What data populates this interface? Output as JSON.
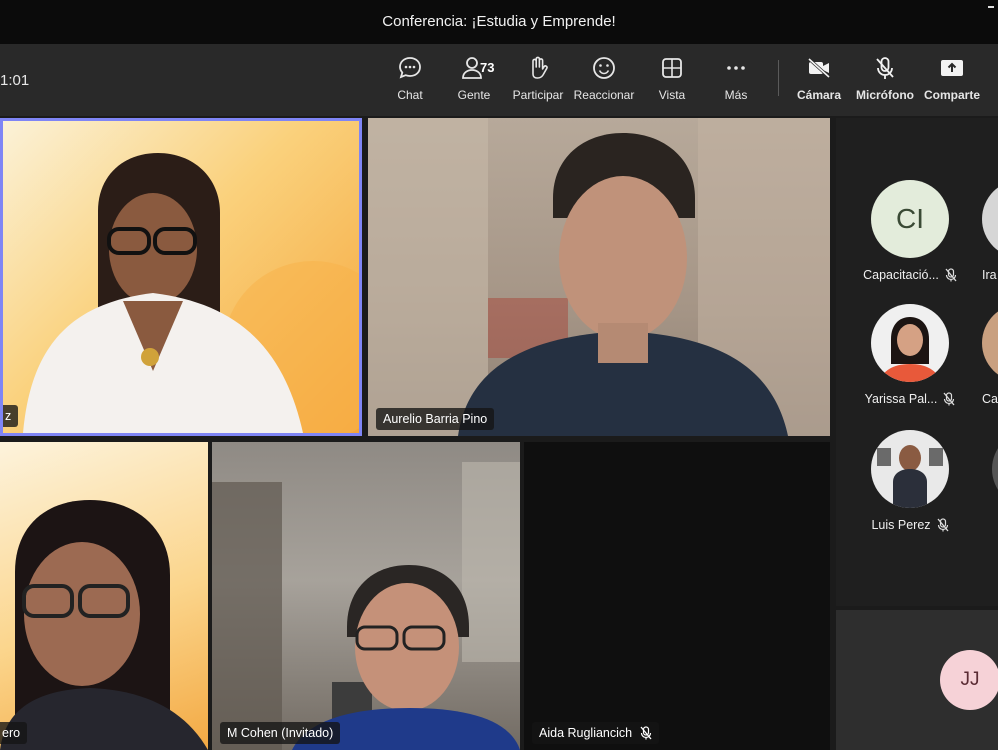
{
  "window": {
    "title": "Conferencia: ¡Estudia y Emprende!"
  },
  "toolbar": {
    "timer": "1:01",
    "people_count": "73",
    "buttons": [
      {
        "label": "Chat",
        "icon": "chat-icon"
      },
      {
        "label": "Gente",
        "icon": "people-icon"
      },
      {
        "label": "Participar",
        "icon": "raise-hand-icon"
      },
      {
        "label": "Reaccionar",
        "icon": "emoji-icon"
      },
      {
        "label": "Vista",
        "icon": "layout-icon"
      },
      {
        "label": "Más",
        "icon": "more-icon"
      },
      {
        "label": "Cámara",
        "icon": "camera-off-icon"
      },
      {
        "label": "Micrófono",
        "icon": "mic-off-icon"
      },
      {
        "label": "Comparte",
        "icon": "share-icon"
      }
    ]
  },
  "tiles": [
    {
      "name": "z",
      "active_speaker": true,
      "accent": "#7f85f5"
    },
    {
      "name": "Aurelio Barria Pino"
    },
    {
      "name": "ero"
    },
    {
      "name": "M Cohen (Invitado)"
    },
    {
      "name": "Aida Rugliancich",
      "muted": true
    }
  ],
  "roster": [
    {
      "initials": "CI",
      "name": "Capacitació...",
      "muted": true
    },
    {
      "name": "Yarissa Pal...",
      "muted": true
    },
    {
      "name": "Luis Perez",
      "muted": true
    }
  ],
  "roster_partial": [
    {
      "name": "Ira"
    },
    {
      "name": "Ca"
    }
  ],
  "self_view": {
    "initials": "JJ"
  }
}
